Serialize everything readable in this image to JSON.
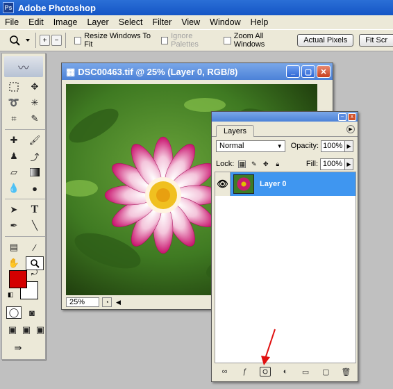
{
  "app": {
    "title": "Adobe Photoshop"
  },
  "menu": [
    "File",
    "Edit",
    "Image",
    "Layer",
    "Select",
    "Filter",
    "View",
    "Window",
    "Help"
  ],
  "options": {
    "resize_windows_label": "Resize Windows To Fit",
    "ignore_palettes_label": "Ignore Palettes",
    "zoom_all_label": "Zoom All Windows",
    "actual_pixels_label": "Actual Pixels",
    "fit_screen_label": "Fit Scr"
  },
  "document": {
    "title": "DSC00463.tif @ 25% (Layer 0, RGB/8)",
    "zoom": "25%"
  },
  "layers_panel": {
    "tab": "Layers",
    "blend_mode": "Normal",
    "opacity_label": "Opacity:",
    "opacity": "100%",
    "lock_label": "Lock:",
    "fill_label": "Fill:",
    "fill": "100%",
    "layers": [
      {
        "name": "Layer 0"
      }
    ]
  },
  "colors": {
    "foreground": "#d40000",
    "background": "#ffffff",
    "selection": "#3f96f0"
  },
  "icons": {
    "bottom_bar": [
      "link-icon",
      "layer-style-icon",
      "add-mask-icon",
      "adjustment-layer-icon",
      "new-group-icon",
      "new-layer-icon",
      "trash-icon"
    ]
  }
}
